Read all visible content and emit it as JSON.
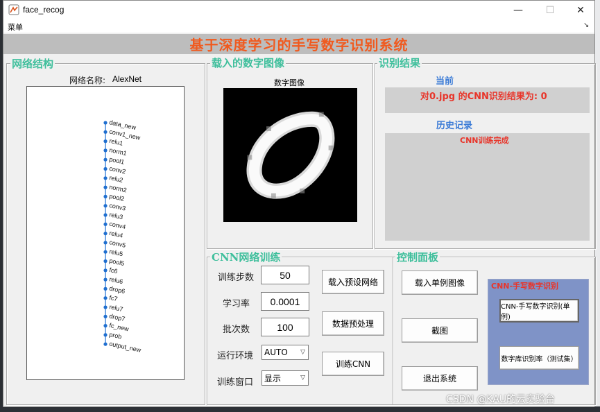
{
  "window": {
    "title": "face_recog",
    "minimize": "—",
    "maximize": "☐",
    "close": "✕"
  },
  "menubar": {
    "menu_label": "菜单"
  },
  "banner": {
    "title": "基于深度学习的手写数字识别系统"
  },
  "network_panel": {
    "title": "网络结构",
    "name_label": "网络名称:",
    "name_value": "AlexNet",
    "layers": [
      "data_new",
      "conv1_new",
      "relu1",
      "norm1",
      "pool1",
      "conv2",
      "relu2",
      "norm2",
      "pool2",
      "conv3",
      "relu3",
      "conv4",
      "relu4",
      "conv5",
      "relu5",
      "pool5",
      "fc6",
      "relu6",
      "drop6",
      "fc7",
      "relu7",
      "drop7",
      "fc_new",
      "prob",
      "output_new"
    ]
  },
  "image_panel": {
    "title": "载入的数字图像",
    "image_title": "数字图像"
  },
  "result_panel": {
    "title": "识别结果",
    "current_label": "当前",
    "current_text": "对0.jpg 的CNN识别结果为: 0",
    "history_label": "历史记录",
    "history_text": "CNN训练完成"
  },
  "training_panel": {
    "title": "CNN网络训练",
    "steps_label": "训练步数",
    "steps_value": "50",
    "lr_label": "学习率",
    "lr_value": "0.0001",
    "batch_label": "批次数",
    "batch_value": "100",
    "env_label": "运行环境",
    "env_value": "AUTO",
    "window_label": "训练窗口",
    "window_value": "显示",
    "load_net_button": "载入预设网络",
    "preprocess_button": "数据预处理",
    "train_button": "训练CNN"
  },
  "control_panel": {
    "title": "控制面板",
    "load_image_button": "载入单例图像",
    "screenshot_button": "截图",
    "exit_button": "退出系统"
  },
  "cnn_panel": {
    "title": "CNN-手写数字识别",
    "single_button": "CNN-手写数字识别(单例)",
    "test_button": "数字库识别率（测试集）"
  },
  "watermark": "CSDN @KAU的云实验台",
  "colors": {
    "accent_teal": "#3fbf9c",
    "banner_orange": "#f05a1f",
    "result_red": "#e8352a",
    "label_blue": "#3b7bd6",
    "node_blue": "#1f6fd0",
    "cnn_panel_bg": "#7f93c7"
  }
}
